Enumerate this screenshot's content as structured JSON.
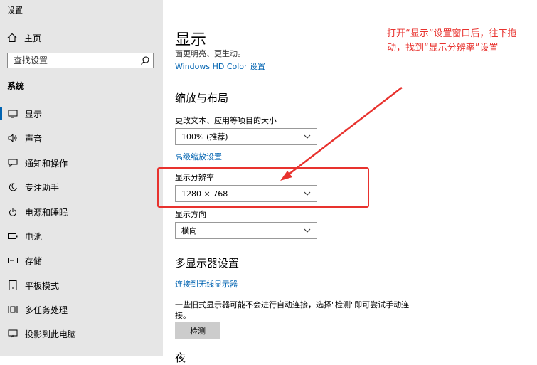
{
  "window": {
    "title": "设置"
  },
  "sidebar": {
    "home_label": "主页",
    "search_placeholder": "查找设置",
    "section_label": "系统",
    "items": [
      {
        "label": "显示",
        "icon": "monitor-icon",
        "active": true
      },
      {
        "label": "声音",
        "icon": "speaker-icon"
      },
      {
        "label": "通知和操作",
        "icon": "notification-icon"
      },
      {
        "label": "专注助手",
        "icon": "moon-icon"
      },
      {
        "label": "电源和睡眠",
        "icon": "power-icon"
      },
      {
        "label": "电池",
        "icon": "battery-icon"
      },
      {
        "label": "存储",
        "icon": "storage-icon"
      },
      {
        "label": "平板模式",
        "icon": "tablet-icon"
      },
      {
        "label": "多任务处理",
        "icon": "multitask-icon"
      },
      {
        "label": "投影到此电脑",
        "icon": "project-icon"
      }
    ]
  },
  "main": {
    "title": "显示",
    "subtitle": "面更明亮、更生动。",
    "hdr_link": "Windows HD Color 设置",
    "scale_heading": "缩放与布局",
    "text_size_label": "更改文本、应用等项目的大小",
    "text_size_value": "100% (推荐)",
    "advanced_scaling_link": "高级缩放设置",
    "resolution_label": "显示分辨率",
    "resolution_value": "1280 × 768",
    "orientation_label": "显示方向",
    "orientation_value": "横向",
    "multi_display_heading": "多显示器设置",
    "wireless_link": "连接到无线显示器",
    "detect_desc": "一些旧式显示器可能不会进行自动连接，选择\"检测\"即可尝试手动连接。",
    "detect_button": "检测",
    "cut_heading": "夜"
  },
  "annotation": {
    "text": "打开“显示”设置窗口后，往下拖动，找到“显示分辨率”设置",
    "color": "#e8322e"
  },
  "colors": {
    "accent": "#0063b1",
    "sidebar_bg": "#e6e6e6"
  }
}
